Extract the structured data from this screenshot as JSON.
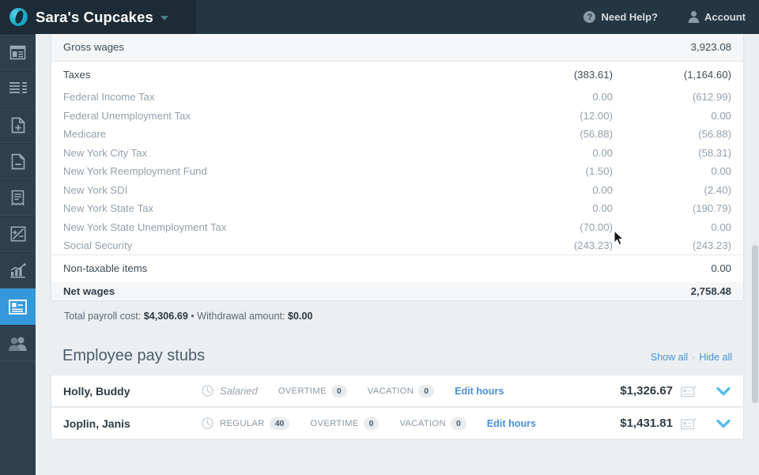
{
  "header": {
    "brand_name": "Sara's Cupcakes",
    "logo_icon": "company-logo-icon",
    "caret_icon": "chevron-down-icon",
    "help_label": "Need Help?",
    "help_icon": "question-mark-circle-icon",
    "account_label": "Account",
    "account_icon": "person-icon",
    "brand_bg": "#1c2b35",
    "bar_bg": "#243642"
  },
  "sidebar": {
    "active_color": "#3498db",
    "bg": "#2f404d",
    "items": [
      {
        "name": "dashboard-icon",
        "label": "Dashboard",
        "active": false
      },
      {
        "name": "list-lines-icon",
        "label": "Reports list",
        "active": false
      },
      {
        "name": "document-plus-icon",
        "label": "Add document",
        "active": false
      },
      {
        "name": "document-minus-icon",
        "label": "Remove document",
        "active": false
      },
      {
        "name": "receipt-icon",
        "label": "Receipts",
        "active": false
      },
      {
        "name": "plus-minus-calculator-icon",
        "label": "Adjustments",
        "active": false
      },
      {
        "name": "chart-trend-icon",
        "label": "Analytics",
        "active": false
      },
      {
        "name": "id-card-payroll-icon",
        "label": "Payroll",
        "active": true
      },
      {
        "name": "people-icon",
        "label": "Employees",
        "active": false
      }
    ]
  },
  "payroll_table": {
    "rows": [
      {
        "label": "Gross wages",
        "type": "major",
        "shade": true,
        "col1": "",
        "col2": "3,923.08"
      },
      {
        "label": "Taxes",
        "type": "major",
        "shade": false,
        "col1": "(383.61)",
        "col2": "(1,164.60)"
      },
      {
        "label": "Federal Income Tax",
        "type": "sub",
        "shade": false,
        "col1": "0.00",
        "col2": "(612.99)"
      },
      {
        "label": "Federal Unemployment Tax",
        "type": "sub",
        "shade": false,
        "col1": "(12.00)",
        "col2": "0.00"
      },
      {
        "label": "Medicare",
        "type": "sub",
        "shade": false,
        "col1": "(56.88)",
        "col2": "(56.88)"
      },
      {
        "label": "New York City Tax",
        "type": "sub",
        "shade": false,
        "col1": "0.00",
        "col2": "(58.31)"
      },
      {
        "label": "New York Reemployment Fund",
        "type": "sub",
        "shade": false,
        "col1": "(1.50)",
        "col2": "0.00"
      },
      {
        "label": "New York SDI",
        "type": "sub",
        "shade": false,
        "col1": "0.00",
        "col2": "(2.40)"
      },
      {
        "label": "New York State Tax",
        "type": "sub",
        "shade": false,
        "col1": "0.00",
        "col2": "(190.79)"
      },
      {
        "label": "New York State Unemployment Tax",
        "type": "sub",
        "shade": false,
        "col1": "(70.00)",
        "col2": "0.00"
      },
      {
        "label": "Social Security",
        "type": "sub",
        "shade": false,
        "col1": "(243.23)",
        "col2": "(243.23)"
      },
      {
        "label": "Non-taxable items",
        "type": "major",
        "shade": false,
        "col1": "",
        "col2": "0.00"
      },
      {
        "label": "Net wages",
        "type": "net",
        "shade": true,
        "col1": "",
        "col2": "2,758.48"
      }
    ],
    "footnote": {
      "cost_label": "Total payroll cost:",
      "cost_value": "$4,306.69",
      "separator": "•",
      "withdrawal_label": "Withdrawal amount:",
      "withdrawal_value": "$0.00"
    }
  },
  "pay_stubs": {
    "title": "Employee pay stubs",
    "show_all": "Show all",
    "separator": "·",
    "hide_all": "Hide all",
    "link_color": "#4a90d9",
    "rows": [
      {
        "name": "Holly, Buddy",
        "clock_icon": "clock-icon",
        "pay_type_label": "Salaried",
        "pay_type_value": "",
        "overtime_label": "OVERTIME",
        "overtime_value": "0",
        "vacation_label": "VACATION",
        "vacation_value": "0",
        "edit_hours": "Edit hours",
        "amount": "$1,326.67",
        "check_icon": "check-voucher-icon",
        "expand_icon": "chevron-down-icon"
      },
      {
        "name": "Joplin, Janis",
        "clock_icon": "clock-icon",
        "pay_type_label": "REGULAR",
        "pay_type_value": "40",
        "overtime_label": "OVERTIME",
        "overtime_value": "0",
        "vacation_label": "VACATION",
        "vacation_value": "0",
        "edit_hours": "Edit hours",
        "amount": "$1,431.81",
        "check_icon": "check-voucher-icon",
        "expand_icon": "chevron-down-icon"
      }
    ]
  }
}
